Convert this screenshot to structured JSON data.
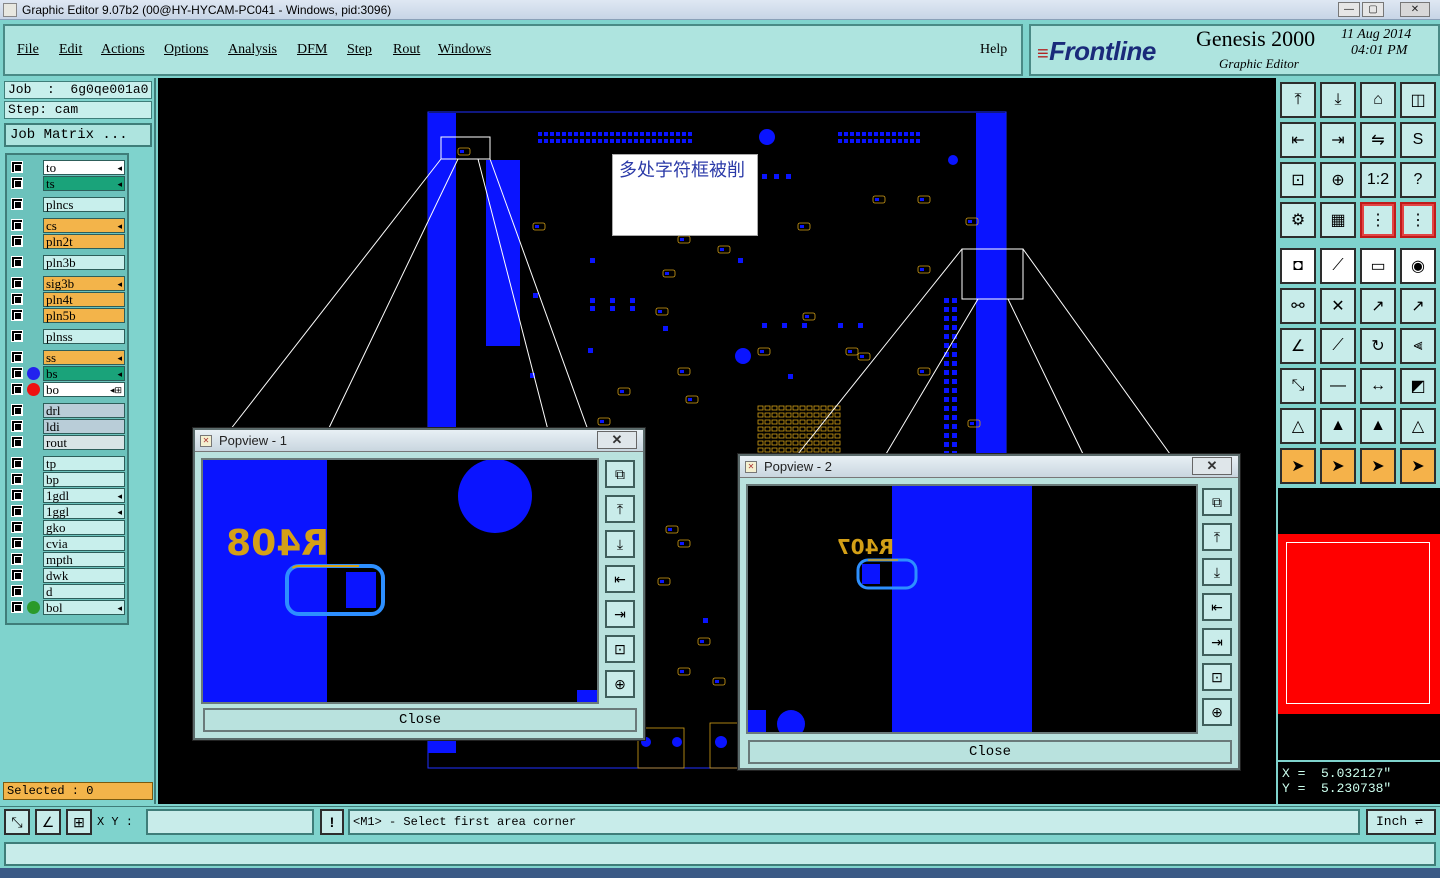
{
  "window": {
    "title": "Graphic Editor 9.07b2 (00@HY-HYCAM-PC041 - Windows, pid:3096)",
    "minimize": "—",
    "maximize": "▢",
    "close": "✕"
  },
  "menu": {
    "items": [
      {
        "label": "File"
      },
      {
        "label": "Edit"
      },
      {
        "label": "Actions"
      },
      {
        "label": "Options"
      },
      {
        "label": "Analysis"
      },
      {
        "label": "DFM"
      },
      {
        "label": "Step"
      },
      {
        "label": "Rout"
      },
      {
        "label": "Windows"
      }
    ],
    "help": "Help"
  },
  "brand": {
    "logo": "Frontline",
    "product": "Genesis 2000",
    "module": "Graphic Editor",
    "date": "11 Aug 2014",
    "time": "04:01 PM"
  },
  "job": {
    "job_label": "Job  :  6g0qe001a0",
    "step_label": "Step: cam",
    "matrix_button": "Job Matrix ..."
  },
  "layers": [
    {
      "name": "to",
      "color": "#ffffff",
      "flag": "◂",
      "dot": ""
    },
    {
      "name": "ts",
      "color": "#1aa37a",
      "flag": "◂",
      "dot": ""
    },
    {
      "name": "plncs",
      "color": "#c8efec",
      "flag": "",
      "dot": ""
    },
    {
      "name": "cs",
      "color": "#f3b44a",
      "flag": "◂",
      "dot": ""
    },
    {
      "name": "pln2t",
      "color": "#f3b44a",
      "flag": "",
      "dot": ""
    },
    {
      "name": "pln3b",
      "color": "#c8efec",
      "flag": "",
      "dot": ""
    },
    {
      "name": "sig3b",
      "color": "#f3b44a",
      "flag": "◂",
      "dot": ""
    },
    {
      "name": "pln4t",
      "color": "#f3b44a",
      "flag": "",
      "dot": ""
    },
    {
      "name": "pln5b",
      "color": "#f3b44a",
      "flag": "",
      "dot": ""
    },
    {
      "name": "plnss",
      "color": "#c8efec",
      "flag": "",
      "dot": ""
    },
    {
      "name": "ss",
      "color": "#f3b44a",
      "flag": "◂",
      "dot": ""
    },
    {
      "name": "bs",
      "color": "#1aa37a",
      "flag": "◂",
      "dot": "#2222ee"
    },
    {
      "name": "bo",
      "color": "#ffffff",
      "flag": "◂⊞",
      "dot": "#ee1111"
    },
    {
      "name": "drl",
      "color": "#b9cdd8",
      "flag": "",
      "dot": ""
    },
    {
      "name": "ldi",
      "color": "#b9cdd8",
      "flag": "",
      "dot": ""
    },
    {
      "name": "rout",
      "color": "#d8e4e6",
      "flag": "",
      "dot": ""
    },
    {
      "name": "tp",
      "color": "#c8efec",
      "flag": "",
      "dot": ""
    },
    {
      "name": "bp",
      "color": "#c8efec",
      "flag": "",
      "dot": ""
    },
    {
      "name": "1gdl",
      "color": "#c8efec",
      "flag": "◂",
      "dot": ""
    },
    {
      "name": "1ggl",
      "color": "#c8efec",
      "flag": "◂",
      "dot": ""
    },
    {
      "name": "gko",
      "color": "#c8efec",
      "flag": "",
      "dot": ""
    },
    {
      "name": "cvia",
      "color": "#c8efec",
      "flag": "",
      "dot": ""
    },
    {
      "name": "mpth",
      "color": "#c8efec",
      "flag": "",
      "dot": ""
    },
    {
      "name": "dwk",
      "color": "#c8efec",
      "flag": "",
      "dot": ""
    },
    {
      "name": "d",
      "color": "#c8efec",
      "flag": "",
      "dot": ""
    },
    {
      "name": "bol",
      "color": "#c8efec",
      "flag": "◂",
      "dot": "#2a9a2a"
    }
  ],
  "selected": "Selected : 0",
  "canvas": {
    "note": "多处字符框被削"
  },
  "popup1": {
    "title": "Popview - 1",
    "close_x": "✕",
    "label": "R408",
    "close_button": "Close"
  },
  "popup2": {
    "title": "Popview - 2",
    "close_x": "✕",
    "label": "R407",
    "close_button": "Close"
  },
  "right_tools": [
    {
      "name": "home-top-icon",
      "glyph": "⤒",
      "style": ""
    },
    {
      "name": "home-bottom-icon",
      "glyph": "⤓",
      "style": ""
    },
    {
      "name": "house-icon",
      "glyph": "⌂",
      "style": ""
    },
    {
      "name": "split-view-icon",
      "glyph": "◫",
      "style": ""
    },
    {
      "name": "pan-left-icon",
      "glyph": "⇤",
      "style": ""
    },
    {
      "name": "pan-right-icon",
      "glyph": "⇥",
      "style": ""
    },
    {
      "name": "mirror-icon",
      "glyph": "⇋",
      "style": ""
    },
    {
      "name": "s-curve-icon",
      "glyph": "S",
      "style": ""
    },
    {
      "name": "zoom-fit-icon",
      "glyph": "⊡",
      "style": ""
    },
    {
      "name": "zoom-center-icon",
      "glyph": "⊕",
      "style": ""
    },
    {
      "name": "ratio-icon",
      "glyph": "1:2",
      "style": ""
    },
    {
      "name": "help-icon",
      "glyph": "?",
      "style": ""
    },
    {
      "name": "settings-icon",
      "glyph": "⚙",
      "style": ""
    },
    {
      "name": "grid-icon",
      "glyph": "▦",
      "style": ""
    },
    {
      "name": "layers-red-icon",
      "glyph": "⋮",
      "style": "red"
    },
    {
      "name": "layers-red2-icon",
      "glyph": "⋮",
      "style": "red"
    },
    {
      "name": "pad-icon",
      "glyph": "◘",
      "style": "white"
    },
    {
      "name": "line-draw-icon",
      "glyph": "⟋",
      "style": "white"
    },
    {
      "name": "ruler-icon",
      "glyph": "▭",
      "style": "white"
    },
    {
      "name": "target-icon",
      "glyph": "◉",
      "style": "white"
    },
    {
      "name": "nodes-icon",
      "glyph": "⚯",
      "style": ""
    },
    {
      "name": "cross-icon",
      "glyph": "✕",
      "style": ""
    },
    {
      "name": "connect-icon",
      "glyph": "↗",
      "style": ""
    },
    {
      "name": "connect2-icon",
      "glyph": "↗",
      "style": ""
    },
    {
      "name": "angle-icon",
      "glyph": "∠",
      "style": ""
    },
    {
      "name": "slope-icon",
      "glyph": "⟋",
      "style": ""
    },
    {
      "name": "rotate-icon",
      "glyph": "↻",
      "style": ""
    },
    {
      "name": "fork-icon",
      "glyph": "⫷",
      "style": ""
    },
    {
      "name": "resize-icon",
      "glyph": "⤡",
      "style": ""
    },
    {
      "name": "cut-line-icon",
      "glyph": "—",
      "style": ""
    },
    {
      "name": "measure-icon",
      "glyph": "↔",
      "style": ""
    },
    {
      "name": "shapes-icon",
      "glyph": "◩",
      "style": ""
    },
    {
      "name": "triangle-icon",
      "glyph": "△",
      "style": ""
    },
    {
      "name": "triangle-up-icon",
      "glyph": "▲",
      "style": ""
    },
    {
      "name": "triangle-red-icon",
      "glyph": "▲",
      "style": ""
    },
    {
      "name": "triangle-arrow-icon",
      "glyph": "△",
      "style": ""
    },
    {
      "name": "pointer-icon",
      "glyph": "➤",
      "style": "orange"
    },
    {
      "name": "pointer-select-icon",
      "glyph": "➤",
      "style": "orange"
    },
    {
      "name": "pointer-circle-icon",
      "glyph": "➤",
      "style": "orange"
    },
    {
      "name": "pointer-nodes-icon",
      "glyph": "➤",
      "style": "orange"
    }
  ],
  "coords": {
    "x": "X =  5.032127\"",
    "y": "Y =  5.230738\""
  },
  "bottom": {
    "xy_label": "X Y :",
    "xy_value": "",
    "warn": "!",
    "prompt": "<M1> - Select first area corner",
    "units": "Inch ⇌"
  },
  "colors": {
    "background": "#7fd3cd",
    "canvas": "#000000",
    "copper": "#0a14ff",
    "silk": "#d4a017"
  }
}
